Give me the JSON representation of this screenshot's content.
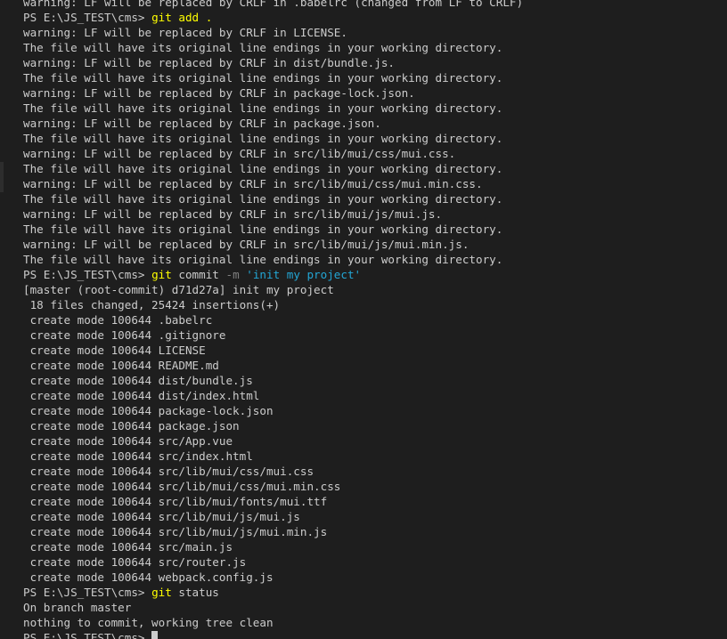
{
  "terminal": {
    "truncated_top_line": "warning: LF will be replaced by CRLF in .babelrc (changed from LF to CRLF)",
    "git_add": {
      "prompt": "PS E:\\JS_TEST\\cms> ",
      "command": "git add ."
    },
    "add_output": [
      "warning: LF will be replaced by CRLF in LICENSE.",
      "The file will have its original line endings in your working directory.",
      "warning: LF will be replaced by CRLF in dist/bundle.js.",
      "The file will have its original line endings in your working directory.",
      "warning: LF will be replaced by CRLF in package-lock.json.",
      "The file will have its original line endings in your working directory.",
      "warning: LF will be replaced by CRLF in package.json.",
      "The file will have its original line endings in your working directory.",
      "warning: LF will be replaced by CRLF in src/lib/mui/css/mui.css.",
      "The file will have its original line endings in your working directory.",
      "warning: LF will be replaced by CRLF in src/lib/mui/css/mui.min.css.",
      "The file will have its original line endings in your working directory.",
      "warning: LF will be replaced by CRLF in src/lib/mui/js/mui.js.",
      "The file will have its original line endings in your working directory.",
      "warning: LF will be replaced by CRLF in src/lib/mui/js/mui.min.js.",
      "The file will have its original line endings in your working directory."
    ],
    "git_commit": {
      "prompt": "PS E:\\JS_TEST\\cms> ",
      "command": "git",
      "subcommand": " commit ",
      "flag": "-m",
      "message": " 'init my project'"
    },
    "commit_output": [
      "[master (root-commit) d71d27a] init my project",
      " 18 files changed, 25424 insertions(+)",
      " create mode 100644 .babelrc",
      " create mode 100644 .gitignore",
      " create mode 100644 LICENSE",
      " create mode 100644 README.md",
      " create mode 100644 dist/bundle.js",
      " create mode 100644 dist/index.html",
      " create mode 100644 package-lock.json",
      " create mode 100644 package.json",
      " create mode 100644 src/App.vue",
      " create mode 100644 src/index.html",
      " create mode 100644 src/lib/mui/css/mui.css",
      " create mode 100644 src/lib/mui/css/mui.min.css",
      " create mode 100644 src/lib/mui/fonts/mui.ttf",
      " create mode 100644 src/lib/mui/js/mui.js",
      " create mode 100644 src/lib/mui/js/mui.min.js",
      " create mode 100644 src/main.js",
      " create mode 100644 src/router.js",
      " create mode 100644 webpack.config.js"
    ],
    "git_status": {
      "prompt": "PS E:\\JS_TEST\\cms> ",
      "command": "git",
      "subcommand": " status"
    },
    "status_output": [
      "On branch master",
      "nothing to commit, working tree clean"
    ],
    "final_prompt": "PS E:\\JS_TEST\\cms> "
  },
  "colors": {
    "background": "#1e1e1e",
    "text": "#cccccc",
    "command": "#ffff00",
    "flag": "#808080",
    "string": "#23a6d5"
  }
}
